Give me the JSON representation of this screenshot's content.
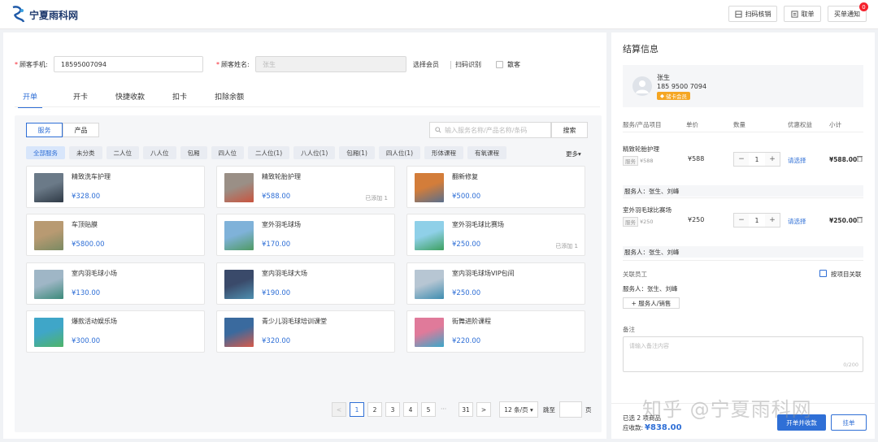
{
  "header": {
    "logo": "宁夏雨科网",
    "scan_btn": "扫码核销",
    "order_btn": "取单",
    "notify_btn": "买单通知",
    "notify_count": "0"
  },
  "form": {
    "phone_label": "顾客手机:",
    "phone_value": "18595007094",
    "name_label": "顾客姓名:",
    "name_value": "张生",
    "choose_member": "选择会员",
    "scan_recognize": "扫码识别",
    "anonymous": "散客"
  },
  "tabs": [
    "开单",
    "开卡",
    "快捷收款",
    "扣卡",
    "扣除余额"
  ],
  "panel": {
    "seg_service": "服务",
    "seg_product": "产品",
    "search_placeholder": "输入服务名称/产品名称/条码",
    "search_btn": "搜索",
    "categories": [
      "全部服务",
      "未分类",
      "二人位",
      "八人位",
      "包厢",
      "四人位",
      "二人位(1)",
      "八人位(1)",
      "包厢(1)",
      "四人位(1)",
      "形体课程",
      "有氧课程"
    ],
    "more": "更多▾",
    "cards": [
      {
        "name": "精致洗车护理",
        "price": "¥328.00",
        "added": "",
        "c1": "#6b7a88",
        "c2": "#2f3a46"
      },
      {
        "name": "精致轮胎护理",
        "price": "¥588.00",
        "added": "已添加 1",
        "c1": "#9a8f86",
        "c2": "#c9543e"
      },
      {
        "name": "翻新修复",
        "price": "¥500.00",
        "added": "",
        "c1": "#d37d3a",
        "c2": "#5a6f8c"
      },
      {
        "name": "车顶贴膜",
        "price": "¥5800.00",
        "added": "",
        "c1": "#b89a72",
        "c2": "#7a8a62"
      },
      {
        "name": "室外羽毛球场",
        "price": "¥170.00",
        "added": "",
        "c1": "#7fb2d9",
        "c2": "#4f9a63"
      },
      {
        "name": "室外羽毛球比赛场",
        "price": "¥250.00",
        "added": "已添加 1",
        "c1": "#8fd0e8",
        "c2": "#3da060"
      },
      {
        "name": "室内羽毛球小场",
        "price": "¥130.00",
        "added": "",
        "c1": "#9fb6c6",
        "c2": "#3b8a7a"
      },
      {
        "name": "室内羽毛球大场",
        "price": "¥190.00",
        "added": "",
        "c1": "#3a4a6a",
        "c2": "#4e8fb0"
      },
      {
        "name": "室内羽毛球场VIP包间",
        "price": "¥250.00",
        "added": "",
        "c1": "#b7c6d3",
        "c2": "#3e8db0"
      },
      {
        "name": "爆款活动娱乐场",
        "price": "¥300.00",
        "added": "",
        "c1": "#3fa6c8",
        "c2": "#4fb468"
      },
      {
        "name": "青少儿羽毛球培训课堂",
        "price": "¥320.00",
        "added": "",
        "c1": "#3a6a9e",
        "c2": "#d85a4a"
      },
      {
        "name": "街舞进阶课程",
        "price": "¥220.00",
        "added": "",
        "c1": "#e07a9a",
        "c2": "#3aa7c9"
      }
    ],
    "pager": {
      "prev": "<",
      "pages": [
        "1",
        "2",
        "3",
        "4",
        "5"
      ],
      "ellipsis": "···",
      "last": "31",
      "next": ">",
      "size": "12 条/页 ▾",
      "goto": "跳至",
      "page_unit": "页"
    }
  },
  "settle": {
    "title": "结算信息",
    "customer_name": "张生",
    "customer_phone": "185 9500 7094",
    "vip_label": "储卡会员",
    "headers": [
      "服务/产品项目",
      "单价",
      "数量",
      "优惠权益",
      "小计"
    ],
    "items": [
      {
        "name": "精致轮胎护理",
        "tag": "服务",
        "orig": "¥588",
        "price": "¥588",
        "qty": "1",
        "choose": "请选择",
        "subtotal": "¥588.00",
        "staff": "服务人：张生、刘峰"
      },
      {
        "name": "室外羽毛球比赛场",
        "tag": "服务",
        "orig": "¥250",
        "price": "¥250",
        "qty": "1",
        "choose": "请选择",
        "subtotal": "¥250.00",
        "staff": "服务人：张生、刘峰"
      }
    ],
    "related_label": "关联员工",
    "by_item": "按项目关联",
    "staff_line": "服务人：张生、刘峰",
    "add_staff": "+ 服务人/销售",
    "remark_label": "备注",
    "remark_placeholder": "请输入备注内容",
    "remark_count": "0/200",
    "selected": "已选 2 项商品",
    "total_label": "应收款:",
    "total": "¥838.00",
    "pay_btn": "开单并收款",
    "hold_btn": "挂单"
  },
  "watermark": "知乎 @宁夏雨科网"
}
